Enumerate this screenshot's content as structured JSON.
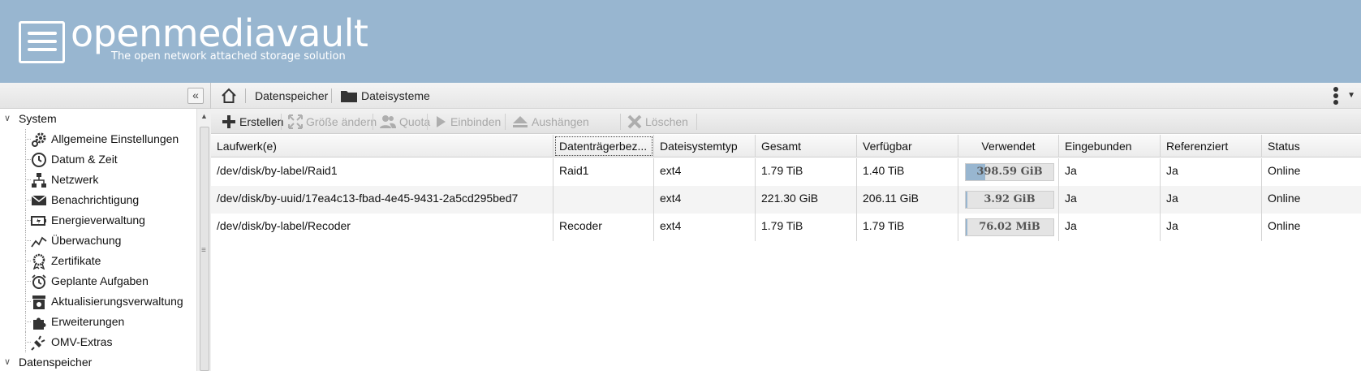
{
  "header": {
    "logo_text": "openmediavault",
    "tagline": "The open network attached storage solution",
    "background": "#98b6d0"
  },
  "sidebar": {
    "collapse_label": "«",
    "groups": [
      {
        "label": "System",
        "items": [
          {
            "label": "Allgemeine Einstellungen",
            "icon": "gears-icon"
          },
          {
            "label": "Datum & Zeit",
            "icon": "clock-icon"
          },
          {
            "label": "Netzwerk",
            "icon": "network-icon"
          },
          {
            "label": "Benachrichtigung",
            "icon": "envelope-icon"
          },
          {
            "label": "Energieverwaltung",
            "icon": "battery-icon"
          },
          {
            "label": "Überwachung",
            "icon": "chart-line-icon"
          },
          {
            "label": "Zertifikate",
            "icon": "certificate-icon"
          },
          {
            "label": "Geplante Aufgaben",
            "icon": "alarm-clock-icon"
          },
          {
            "label": "Aktualisierungsverwaltung",
            "icon": "package-icon"
          },
          {
            "label": "Erweiterungen",
            "icon": "puzzle-icon"
          },
          {
            "label": "OMV-Extras",
            "icon": "plug-icon"
          }
        ]
      },
      {
        "label": "Datenspeicher",
        "items": []
      }
    ]
  },
  "breadcrumb": {
    "items": [
      {
        "label": "Datenspeicher"
      },
      {
        "label": "Dateisysteme"
      }
    ]
  },
  "toolbar": {
    "buttons": [
      {
        "label": "Erstellen",
        "icon": "plus-icon",
        "enabled": true
      },
      {
        "label": "Größe ändern",
        "icon": "resize-icon",
        "enabled": false
      },
      {
        "label": "Quota",
        "icon": "users-icon",
        "enabled": false
      },
      {
        "label": "Einbinden",
        "icon": "play-icon",
        "enabled": false
      },
      {
        "label": "Aushängen",
        "icon": "eject-icon",
        "enabled": false
      },
      {
        "label": "Löschen",
        "icon": "x-icon",
        "enabled": false
      }
    ]
  },
  "grid": {
    "columns": [
      "Laufwerk(e)",
      "Datenträgerbez...",
      "Dateisystemtyp",
      "Gesamt",
      "Verfügbar",
      "Verwendet",
      "Eingebunden",
      "Referenziert",
      "Status"
    ],
    "rows": [
      {
        "device": "/dev/disk/by-label/Raid1",
        "label": "Raid1",
        "type": "ext4",
        "total": "1.79 TiB",
        "available": "1.40 TiB",
        "used": "398.59 GiB",
        "used_fraction": 0.22,
        "mounted": "Ja",
        "referenced": "Ja",
        "status": "Online"
      },
      {
        "device": "/dev/disk/by-uuid/17ea4c13-fbad-4e45-9431-2a5cd295bed7",
        "label": "",
        "type": "ext4",
        "total": "221.30 GiB",
        "available": "206.11 GiB",
        "used": "3.92 GiB",
        "used_fraction": 0.02,
        "mounted": "Ja",
        "referenced": "Ja",
        "status": "Online"
      },
      {
        "device": "/dev/disk/by-label/Recoder",
        "label": "Recoder",
        "type": "ext4",
        "total": "1.79 TiB",
        "available": "1.79 TiB",
        "used": "76.02 MiB",
        "used_fraction": 0.01,
        "mounted": "Ja",
        "referenced": "Ja",
        "status": "Online"
      }
    ]
  }
}
